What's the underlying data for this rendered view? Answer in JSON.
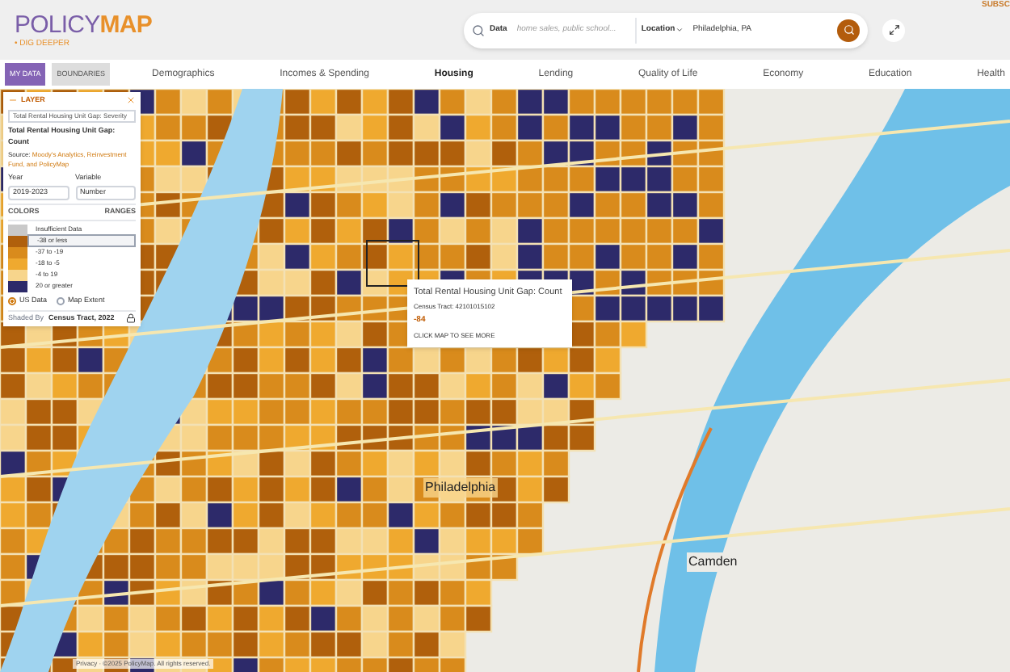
{
  "header": {
    "logo_main": "POLICY",
    "logo_accent": "MAP",
    "tagline": "• DIG DEEPER",
    "subscribe": "SUBSC",
    "search": {
      "data_label": "Data",
      "placeholder": "home sales, public school...",
      "location_label": "Location",
      "location_value": "Philadelphia, PA"
    }
  },
  "nav": {
    "buttons": [
      {
        "label": "MY DATA",
        "selected": true
      },
      {
        "label": "BOUNDARIES",
        "selected": false
      }
    ],
    "tabs": [
      {
        "label": "Demographics",
        "selected": false
      },
      {
        "label": "Incomes & Spending",
        "selected": false
      },
      {
        "label": "Housing",
        "selected": true
      },
      {
        "label": "Lending",
        "selected": false
      },
      {
        "label": "Quality of Life",
        "selected": false
      },
      {
        "label": "Economy",
        "selected": false
      },
      {
        "label": "Education",
        "selected": false
      },
      {
        "label": "Health",
        "selected": false
      }
    ]
  },
  "layer_panel": {
    "title": "LAYER",
    "layer_select": "Total Rental Housing Unit Gap: Severity",
    "indicator": "Total Rental Housing Unit Gap: Count",
    "source_label": "Source:",
    "source": "Moody's Analytics, Reinvestment Fund, and PolicyMap",
    "year_label": "Year",
    "year": "2019-2023",
    "variable_label": "Variable",
    "variable": "Number",
    "colors_label": "COLORS",
    "ranges_label": "RANGES",
    "legend": [
      {
        "label": "Insufficient Data",
        "color": "#c9c9c9",
        "selected": false
      },
      {
        "label": "-38 or less",
        "color": "#b0600c",
        "selected": true
      },
      {
        "label": "-37 to -19",
        "color": "#d98b1c",
        "selected": false
      },
      {
        "label": "-18 to -5",
        "color": "#efa92f",
        "selected": false
      },
      {
        "label": "-4 to 19",
        "color": "#f7d58c",
        "selected": false
      },
      {
        "label": "20 or greater",
        "color": "#2d2a6a",
        "selected": false
      }
    ],
    "extent": [
      {
        "label": "US Data",
        "selected": true
      },
      {
        "label": "Map Extent",
        "selected": false
      }
    ],
    "shaded_by_label": "Shaded By",
    "shaded_by": "Census Tract, 2022"
  },
  "popup": {
    "title": "Total Rental Housing Unit Gap: Count",
    "tract": "Census Tract: 42101015102",
    "value": "-84",
    "action": "CLICK MAP TO SEE MORE"
  },
  "map": {
    "labels": [
      "Philadelphia",
      "Camden"
    ],
    "attribution": "Privacy · ©2025 PolicyMap. All rights reserved."
  }
}
